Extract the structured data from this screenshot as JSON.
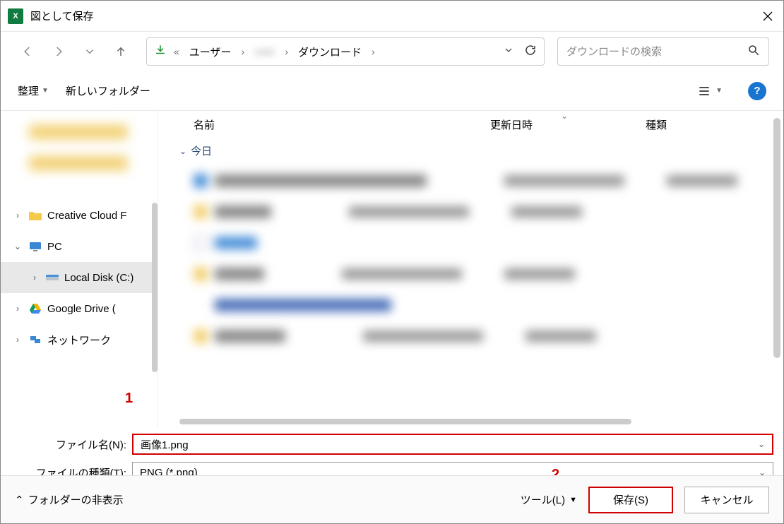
{
  "title": "図として保存",
  "breadcrumbs": {
    "b0": "«",
    "b1": "ユーザー",
    "b2": "",
    "b3": "ダウンロード"
  },
  "search_placeholder": "ダウンロードの検索",
  "toolbar": {
    "organize": "整理",
    "newfolder": "新しいフォルダー"
  },
  "columns": {
    "name": "名前",
    "date": "更新日時",
    "type": "種類"
  },
  "group": {
    "today": "今日"
  },
  "sidebar": {
    "s0": "Creative Cloud F",
    "s1": "PC",
    "s2": "Local Disk (C:)",
    "s3": "Google Drive (",
    "s4": "ネットワーク"
  },
  "form": {
    "filename_label": "ファイル名(N):",
    "filetype_label": "ファイルの種類(T):",
    "filename_value": "画像1.png",
    "filetype_value": "PNG (*.png)"
  },
  "footer": {
    "hidefolders": "フォルダーの非表示",
    "tools": "ツール(L)",
    "save": "保存(S)",
    "cancel": "キャンセル"
  },
  "markers": {
    "one": "1",
    "two": "2"
  }
}
